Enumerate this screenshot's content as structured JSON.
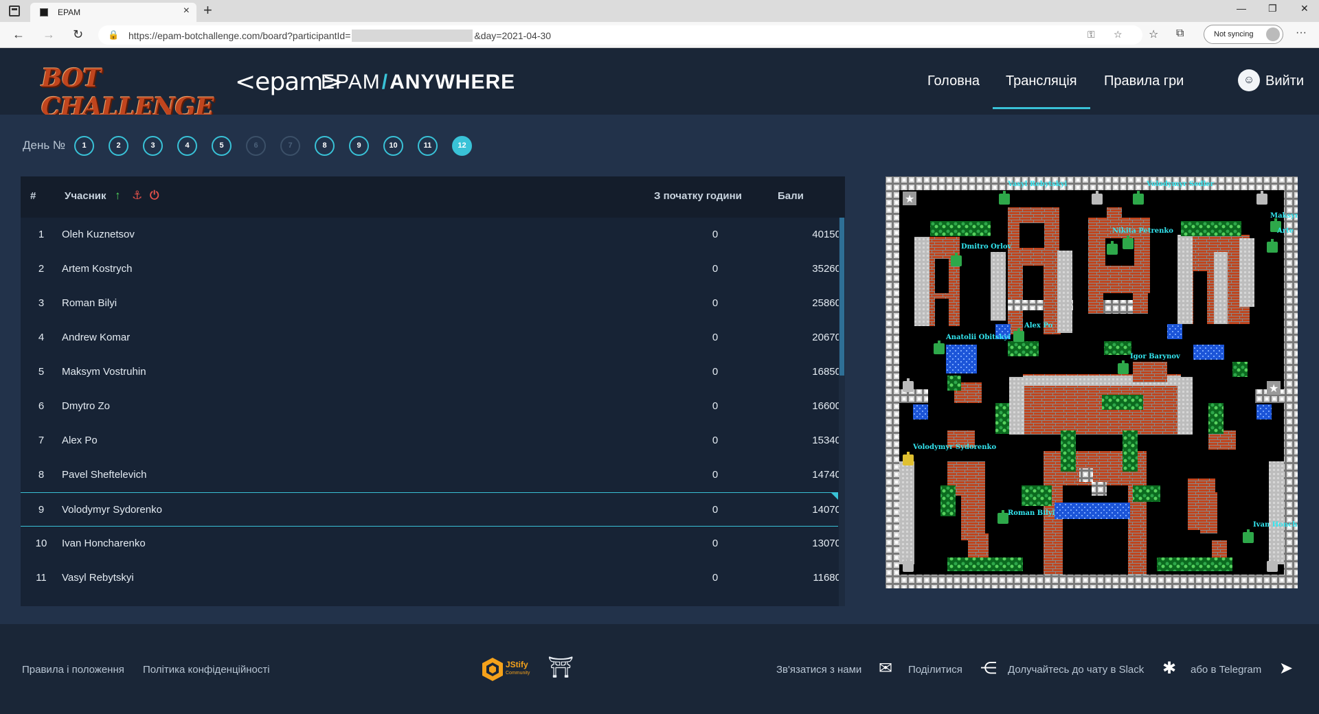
{
  "browser": {
    "tab_title": "EPAM",
    "url_prefix": "https://epam-botchallenge.com/board?participantId=",
    "url_suffix": "&day=2021-04-30",
    "sync_label": "Not syncing"
  },
  "header": {
    "logo_bot": "BOT CHALLENGE",
    "logo_epam": "<epam>",
    "logo_anywhere_a": "EPAM",
    "logo_anywhere_b": "ANYWHERE",
    "nav": [
      "Головна",
      "Трансляція",
      "Правила гри"
    ],
    "logout": "Вийти"
  },
  "days": {
    "label": "День №",
    "items": [
      "1",
      "2",
      "3",
      "4",
      "5",
      "6",
      "7",
      "8",
      "9",
      "10",
      "11",
      "12"
    ],
    "disabled": [
      "6",
      "7"
    ],
    "current": "12"
  },
  "board": {
    "col_num": "#",
    "col_name": "Учасник",
    "col_hours": "З початку години",
    "col_points": "Бали",
    "rows": [
      {
        "num": "1",
        "name": "Oleh Kuznetsov",
        "hours": "0",
        "points": "40150"
      },
      {
        "num": "2",
        "name": "Artem Kostrych",
        "hours": "0",
        "points": "35260"
      },
      {
        "num": "3",
        "name": "Roman Bilyi",
        "hours": "0",
        "points": "25860"
      },
      {
        "num": "4",
        "name": "Andrew Komar",
        "hours": "0",
        "points": "20670"
      },
      {
        "num": "5",
        "name": "Maksym Vostruhin",
        "hours": "0",
        "points": "16850"
      },
      {
        "num": "6",
        "name": "Dmytro Zo",
        "hours": "0",
        "points": "16600"
      },
      {
        "num": "7",
        "name": "Alex Po",
        "hours": "0",
        "points": "15340"
      },
      {
        "num": "8",
        "name": "Pavel Sheftelevich",
        "hours": "0",
        "points": "14740"
      },
      {
        "num": "9",
        "name": "Volodymyr Sydorenko",
        "hours": "0",
        "points": "14070",
        "selected": true
      },
      {
        "num": "10",
        "name": "Ivan Honcharenko",
        "hours": "0",
        "points": "13070"
      },
      {
        "num": "11",
        "name": "Vasyl Rebytskyi",
        "hours": "0",
        "points": "11680"
      }
    ]
  },
  "game": {
    "players": [
      "Vasyl Rebytskyi",
      "Volodymyr Sedler",
      "Maksym",
      "Arte",
      "Nikita Petrenko",
      "Dmitro Orlov",
      "Alex Po",
      "Anatolii Obitskyi",
      "Igor Barynov",
      "Volodymyr Sydorenko",
      "Roman Bilyi",
      "Ivan Honcha"
    ]
  },
  "footer": {
    "rules": "Правила і положення",
    "privacy": "Політика конфіденційності",
    "jstify": "JStify",
    "jstify_sub": "Community",
    "contact": "Зв'язатися з нами",
    "share": "Поділитися",
    "slack": "Долучайтесь до чату в Slack",
    "telegram": "або в Telegram"
  },
  "colors": {
    "accent": "#39c2d7",
    "header_bg": "#1a2637",
    "main_bg": "#22324a",
    "brick": "#c0451e",
    "grass": "#2ea84a",
    "water": "#1c55d8"
  }
}
